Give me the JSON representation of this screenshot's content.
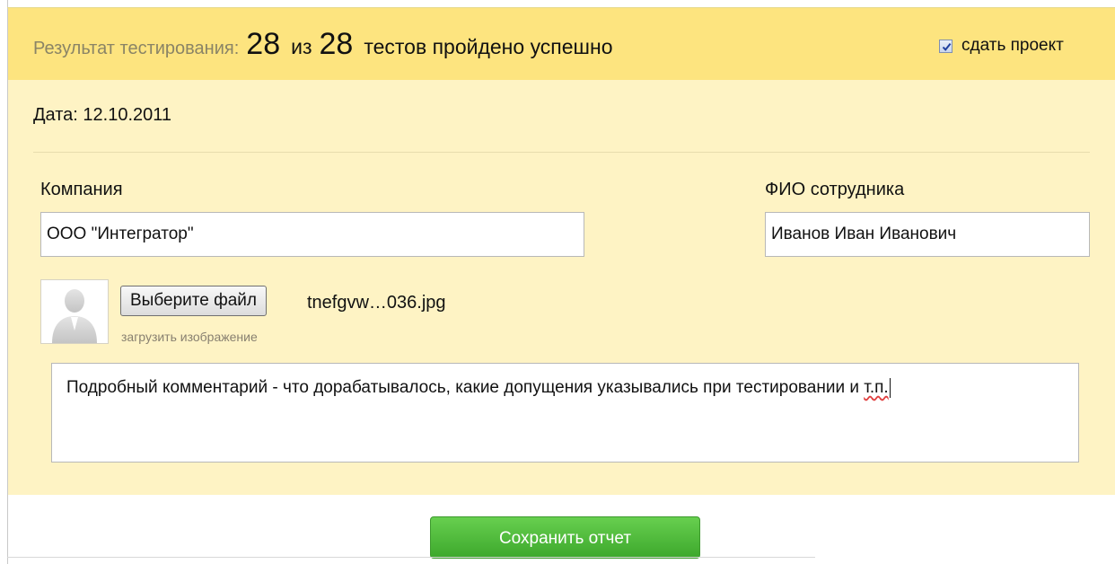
{
  "header": {
    "result_label": "Результат тестирования:",
    "passed": "28",
    "of_word": "из",
    "total": "28",
    "result_suffix": "тестов пройдено успешно",
    "submit_project_label": "сдать проект",
    "submit_project_checked": true
  },
  "date": {
    "label": "Дата:",
    "value": "12.10.2011"
  },
  "company": {
    "label": "Компания",
    "value": "ООО \"Интегратор\""
  },
  "employee": {
    "label": "ФИО сотрудника",
    "value": "Иванов Иван Иванович"
  },
  "upload": {
    "button_label": "Выберите файл",
    "file_name": "tnefgvw…036.jpg",
    "hint": "загрузить изображение",
    "avatar_icon": "user-silhouette-icon"
  },
  "comment": {
    "text_main": "Подробный комментарий - что дорабатывалось, какие допущения указывались при тестировании и ",
    "text_misspelled": "т.п."
  },
  "actions": {
    "save_label": "Сохранить отчет"
  },
  "colors": {
    "header_bg": "#fde47f",
    "panel_bg": "#fef3c4",
    "save_button": "#4cb839",
    "checkbox_check": "#1f3f9e"
  }
}
